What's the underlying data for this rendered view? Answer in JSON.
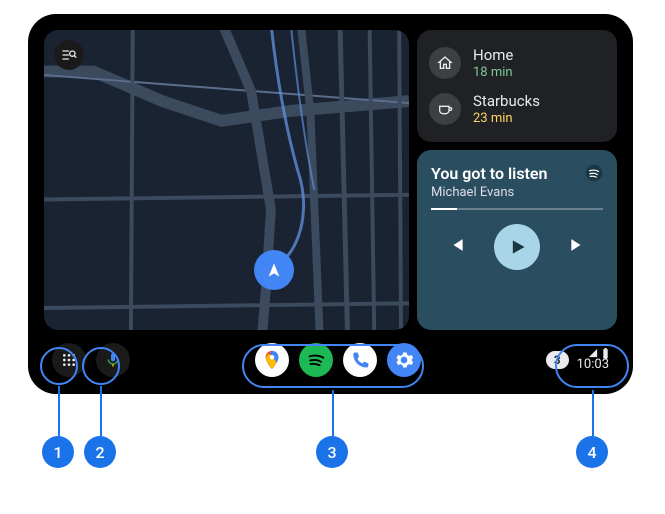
{
  "destinations": [
    {
      "name": "Home",
      "time": "18 min",
      "color": "green",
      "icon": "home"
    },
    {
      "name": "Starbucks",
      "time": "23 min",
      "color": "orange",
      "icon": "coffee"
    }
  ],
  "media": {
    "title": "You got to listen",
    "artist": "Michael Evans",
    "progress": 15
  },
  "statusbar": {
    "notification_count": "3",
    "time": "10:03"
  },
  "callouts": {
    "n1": "1",
    "n2": "2",
    "n3": "3",
    "n4": "4"
  }
}
